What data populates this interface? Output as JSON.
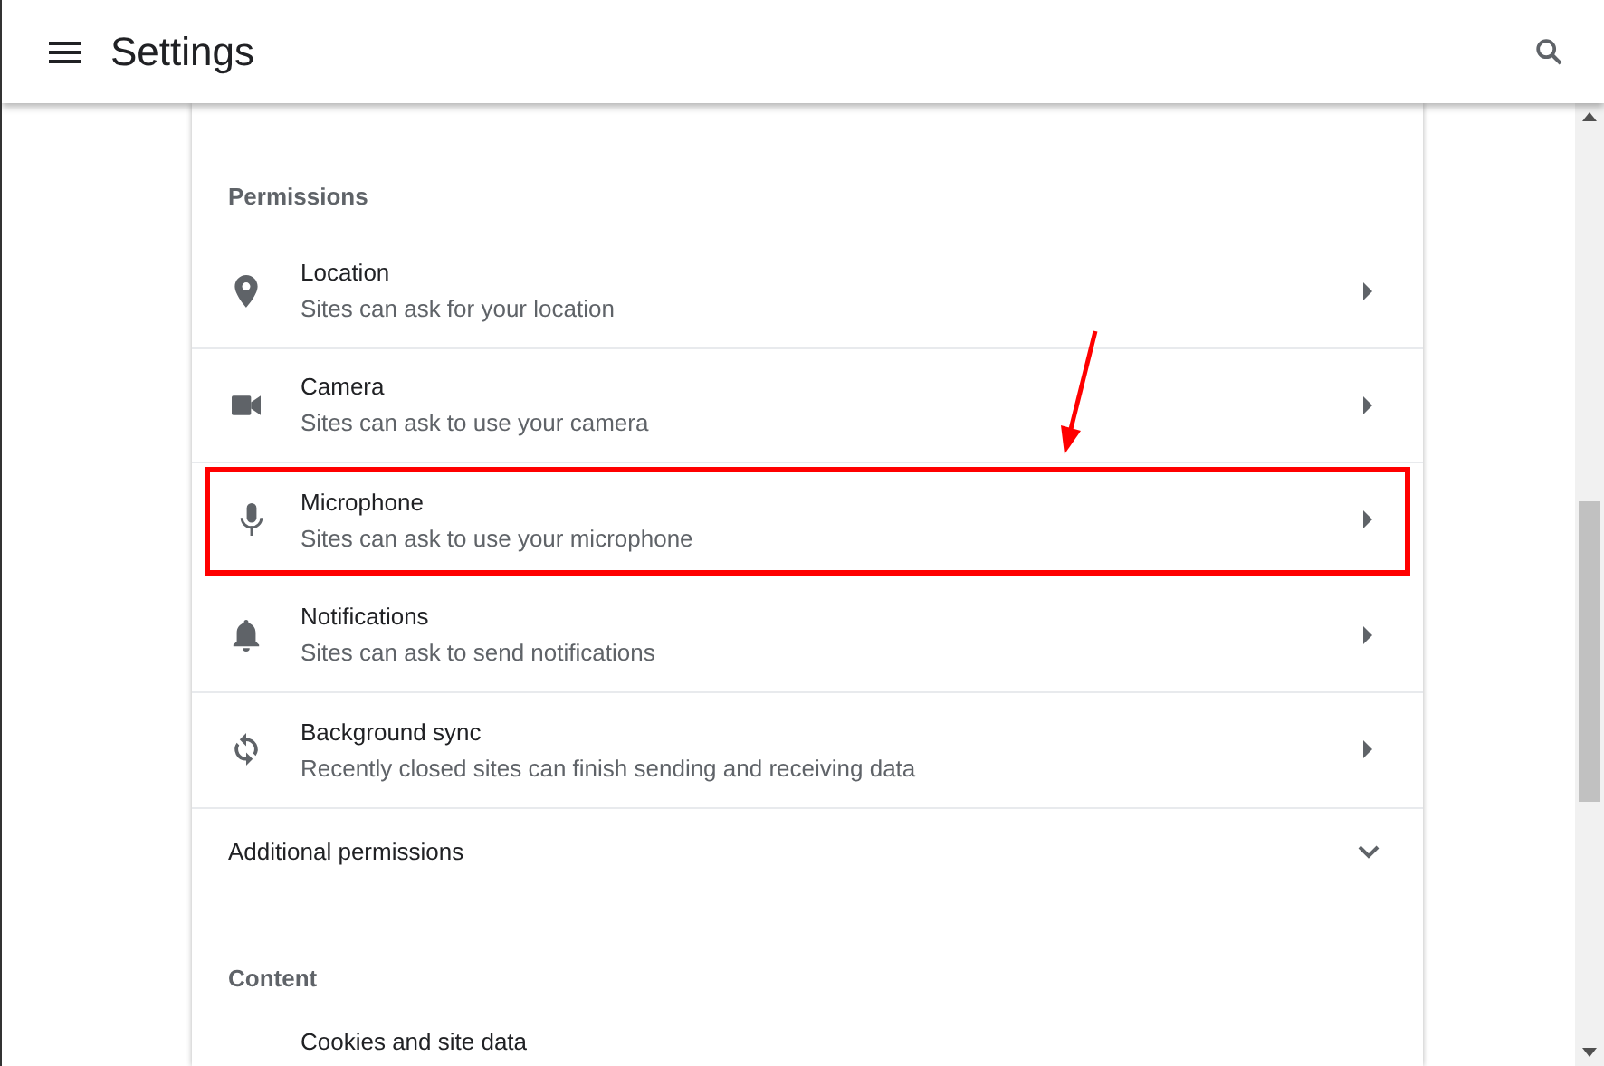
{
  "header": {
    "title": "Settings"
  },
  "sections": [
    {
      "heading": "Permissions",
      "items": [
        {
          "kind": "location",
          "title": "Location",
          "subtitle": "Sites can ask for your location",
          "highlighted": false
        },
        {
          "kind": "camera",
          "title": "Camera",
          "subtitle": "Sites can ask to use your camera",
          "highlighted": false
        },
        {
          "kind": "microphone",
          "title": "Microphone",
          "subtitle": "Sites can ask to use your microphone",
          "highlighted": true
        },
        {
          "kind": "notifications",
          "title": "Notifications",
          "subtitle": "Sites can ask to send notifications",
          "highlighted": false
        },
        {
          "kind": "sync",
          "title": "Background sync",
          "subtitle": "Recently closed sites can finish sending and receiving data",
          "highlighted": false
        }
      ],
      "expander": {
        "label": "Additional permissions",
        "expanded": false
      }
    },
    {
      "heading": "Content",
      "items": [
        {
          "kind": "cookies",
          "title": "Cookies and site data",
          "highlighted": false
        }
      ]
    }
  ]
}
